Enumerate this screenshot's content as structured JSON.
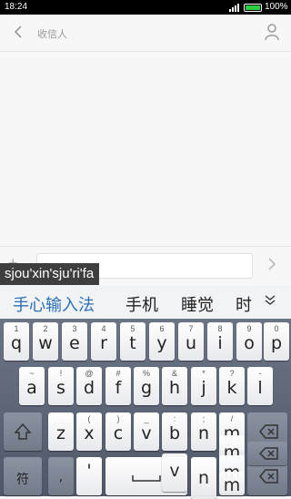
{
  "status_bar": {
    "time": "18:24",
    "battery": "100%"
  },
  "header": {
    "title": "收信人"
  },
  "composer": {
    "input_value": ""
  },
  "ime": {
    "pinyin": "sjou'xin'sju'ri'fa",
    "candidates": [
      "手心输入法",
      "手机",
      "睡觉",
      "时"
    ],
    "rows": {
      "row1": [
        {
          "hint": "1",
          "key": "q"
        },
        {
          "hint": "2",
          "key": "w"
        },
        {
          "hint": "3",
          "key": "e"
        },
        {
          "hint": "4",
          "key": "r"
        },
        {
          "hint": "5",
          "key": "t"
        },
        {
          "hint": "6",
          "key": "y"
        },
        {
          "hint": "7",
          "key": "u"
        },
        {
          "hint": "8",
          "key": "i"
        },
        {
          "hint": "9",
          "key": "o"
        },
        {
          "hint": "0",
          "key": "p"
        }
      ],
      "row2": [
        {
          "hint": "~",
          "key": "a"
        },
        {
          "hint": "!",
          "key": "s"
        },
        {
          "hint": "@",
          "key": "d"
        },
        {
          "hint": "#",
          "key": "f"
        },
        {
          "hint": "%",
          "key": "g"
        },
        {
          "hint": "&",
          "key": "h"
        },
        {
          "hint": "*",
          "key": "j"
        },
        {
          "hint": "?",
          "key": "k"
        },
        {
          "hint": "-",
          "key": "l"
        }
      ],
      "row3": [
        {
          "hint": "",
          "key": "z"
        },
        {
          "hint": "(",
          "key": "x"
        },
        {
          "hint": ")",
          "key": "c"
        },
        {
          "hint": "_",
          "key": "v"
        },
        {
          "hint": ":",
          "key": "b"
        },
        {
          "hint": ";",
          "key": "n"
        },
        {
          "hint": "/",
          "key": "m"
        }
      ],
      "row4": {
        "symbol_key": "符",
        "comma": ",",
        "period": "。"
      }
    },
    "ghost_keys": [
      "v",
      "m",
      "m",
      "n",
      "m"
    ]
  },
  "icons": [
    "back-arrow-icon",
    "contact-icon",
    "plus-icon",
    "send-arrow-icon",
    "chevron-down-icon",
    "shift-icon",
    "backspace-icon",
    "space-bar-icon",
    "signal-icon",
    "battery-icon"
  ]
}
